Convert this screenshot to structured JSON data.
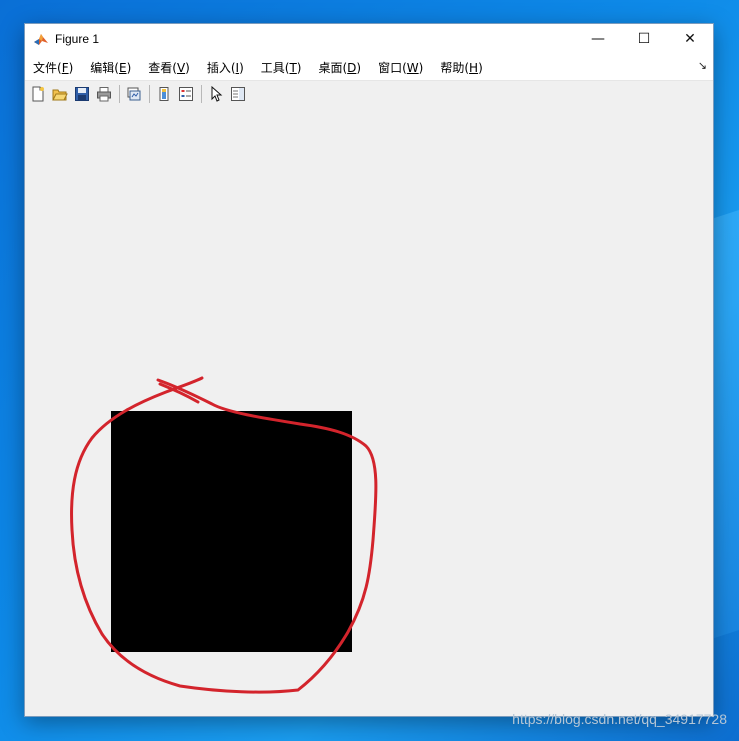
{
  "window": {
    "title": "Figure 1",
    "controls": {
      "minimize": "—",
      "maximize": "☐",
      "close": "✕"
    }
  },
  "menu": {
    "items": [
      {
        "label": "文件(",
        "key": "F",
        "tail": ")"
      },
      {
        "label": "编辑(",
        "key": "E",
        "tail": ")"
      },
      {
        "label": "查看(",
        "key": "V",
        "tail": ")"
      },
      {
        "label": "插入(",
        "key": "I",
        "tail": ")"
      },
      {
        "label": "工具(",
        "key": "T",
        "tail": ")"
      },
      {
        "label": "桌面(",
        "key": "D",
        "tail": ")"
      },
      {
        "label": "窗口(",
        "key": "W",
        "tail": ")"
      },
      {
        "label": "帮助(",
        "key": "H",
        "tail": ")"
      }
    ],
    "dock_arrow": "↘"
  },
  "toolbar": {
    "icons": [
      "new-figure-icon",
      "open-file-icon",
      "save-icon",
      "print-icon",
      "link-plot-icon",
      "insert-colorbar-icon",
      "insert-legend-icon",
      "edit-plot-arrow-icon",
      "property-inspector-icon"
    ]
  },
  "colors": {
    "annotation": "#d3242c",
    "square": "#000000",
    "canvas": "#f0f0f0"
  },
  "watermark": "https://blog.csdn.net/qq_34917728"
}
